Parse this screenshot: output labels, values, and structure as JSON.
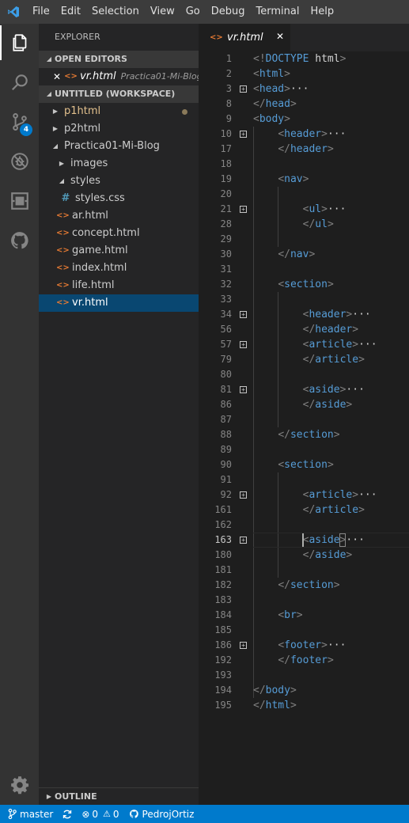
{
  "menu": [
    "File",
    "Edit",
    "Selection",
    "View",
    "Go",
    "Debug",
    "Terminal",
    "Help"
  ],
  "activity": {
    "scm_badge": "4"
  },
  "sidebar": {
    "title": "EXPLORER",
    "open_editors": {
      "header": "OPEN EDITORS",
      "items": [
        {
          "name": "vr.html",
          "desc": "Practica01-Mi-Blog"
        }
      ]
    },
    "workspace": {
      "header": "UNTITLED (WORKSPACE)",
      "tree": [
        {
          "label": "p1html",
          "kind": "folder",
          "state": "collapsed",
          "modified": true
        },
        {
          "label": "p2html",
          "kind": "folder",
          "state": "collapsed"
        },
        {
          "label": "Practica01-Mi-Blog",
          "kind": "folder",
          "state": "expanded"
        },
        {
          "label": "images",
          "kind": "folder",
          "state": "collapsed"
        },
        {
          "label": "styles",
          "kind": "folder",
          "state": "expanded"
        },
        {
          "label": "styles.css",
          "kind": "css"
        },
        {
          "label": "ar.html",
          "kind": "html"
        },
        {
          "label": "concept.html",
          "kind": "html"
        },
        {
          "label": "game.html",
          "kind": "html"
        },
        {
          "label": "index.html",
          "kind": "html"
        },
        {
          "label": "life.html",
          "kind": "html"
        },
        {
          "label": "vr.html",
          "kind": "html",
          "selected": true
        }
      ]
    },
    "outline_header": "OUTLINE"
  },
  "editor": {
    "tab": "vr.html",
    "active_line": "163",
    "lines": [
      {
        "n": "1",
        "code": "<!DOCTYPE html>"
      },
      {
        "n": "2",
        "code": "<html>"
      },
      {
        "n": "3",
        "code": "<head>···",
        "fold": true
      },
      {
        "n": "8",
        "code": "</head>"
      },
      {
        "n": "9",
        "code": "<body>"
      },
      {
        "n": "10",
        "code": "    <header>···",
        "fold": true
      },
      {
        "n": "17",
        "code": "    </header>"
      },
      {
        "n": "18",
        "code": ""
      },
      {
        "n": "19",
        "code": "    <nav>"
      },
      {
        "n": "20",
        "code": ""
      },
      {
        "n": "21",
        "code": "        <ul>···",
        "fold": true
      },
      {
        "n": "28",
        "code": "        </ul>"
      },
      {
        "n": "29",
        "code": ""
      },
      {
        "n": "30",
        "code": "    </nav>"
      },
      {
        "n": "31",
        "code": ""
      },
      {
        "n": "32",
        "code": "    <section>"
      },
      {
        "n": "33",
        "code": ""
      },
      {
        "n": "34",
        "code": "        <header>···",
        "fold": true
      },
      {
        "n": "56",
        "code": "        </header>"
      },
      {
        "n": "57",
        "code": "        <article>···",
        "fold": true
      },
      {
        "n": "79",
        "code": "        </article>"
      },
      {
        "n": "80",
        "code": ""
      },
      {
        "n": "81",
        "code": "        <aside>···",
        "fold": true
      },
      {
        "n": "86",
        "code": "        </aside>"
      },
      {
        "n": "87",
        "code": ""
      },
      {
        "n": "88",
        "code": "    </section>"
      },
      {
        "n": "89",
        "code": ""
      },
      {
        "n": "90",
        "code": "    <section>"
      },
      {
        "n": "91",
        "code": ""
      },
      {
        "n": "92",
        "code": "        <article>···",
        "fold": true
      },
      {
        "n": "161",
        "code": "        </article>"
      },
      {
        "n": "162",
        "code": ""
      },
      {
        "n": "163",
        "code": "        <aside>···",
        "fold": true
      },
      {
        "n": "180",
        "code": "        </aside>"
      },
      {
        "n": "181",
        "code": ""
      },
      {
        "n": "182",
        "code": "    </section>"
      },
      {
        "n": "183",
        "code": ""
      },
      {
        "n": "184",
        "code": "    <br>"
      },
      {
        "n": "185",
        "code": ""
      },
      {
        "n": "186",
        "code": "    <footer>···",
        "fold": true
      },
      {
        "n": "192",
        "code": "    </footer>"
      },
      {
        "n": "193",
        "code": ""
      },
      {
        "n": "194",
        "code": "</body>"
      },
      {
        "n": "195",
        "code": "</html>"
      }
    ]
  },
  "statusbar": {
    "branch": "master",
    "errors": "0",
    "warnings": "0",
    "user": "PedrojOrtiz"
  },
  "colors": {
    "accent": "#007acc",
    "selection": "#094771",
    "tag": "#569cd6",
    "html_icon": "#e37933",
    "css_icon": "#519aba"
  }
}
